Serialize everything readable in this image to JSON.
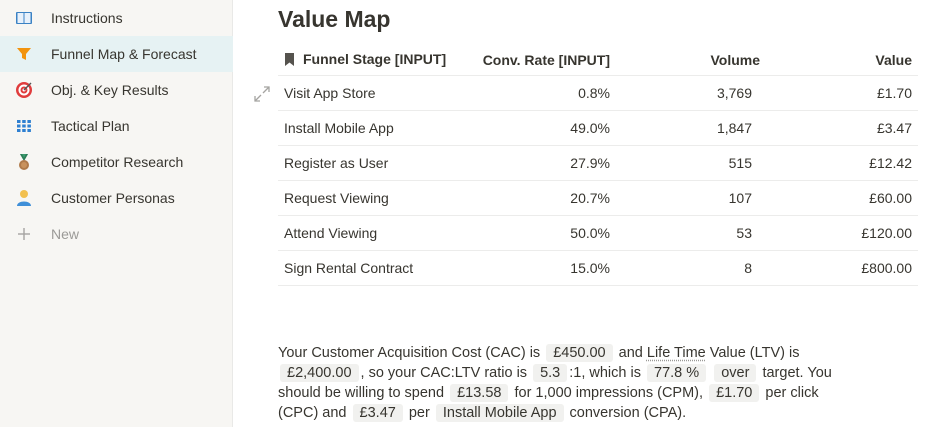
{
  "sidebar": {
    "items": [
      {
        "label": "Instructions",
        "icon": "book-icon"
      },
      {
        "label": "Funnel Map & Forecast",
        "icon": "funnel-icon",
        "active": true
      },
      {
        "label": "Obj. & Key Results",
        "icon": "target-icon"
      },
      {
        "label": "Tactical Plan",
        "icon": "grid-icon"
      },
      {
        "label": "Competitor Research",
        "icon": "medal-icon"
      },
      {
        "label": "Customer Personas",
        "icon": "person-icon"
      }
    ],
    "new_label": "New"
  },
  "page": {
    "title": "Value Map"
  },
  "table": {
    "headers": [
      "Funnel Stage [INPUT]",
      "Conv. Rate [INPUT]",
      "Volume",
      "Value"
    ],
    "rows": [
      {
        "stage": "Visit App Store",
        "rate": "0.8%",
        "volume": "3,769",
        "value": "£1.70"
      },
      {
        "stage": "Install Mobile App",
        "rate": "49.0%",
        "volume": "1,847",
        "value": "£3.47"
      },
      {
        "stage": "Register as User",
        "rate": "27.9%",
        "volume": "515",
        "value": "£12.42"
      },
      {
        "stage": "Request Viewing",
        "rate": "20.7%",
        "volume": "107",
        "value": "£60.00"
      },
      {
        "stage": "Attend Viewing",
        "rate": "50.0%",
        "volume": "53",
        "value": "£120.00"
      },
      {
        "stage": "Sign Rental Contract",
        "rate": "15.0%",
        "volume": "8",
        "value": "£800.00"
      }
    ]
  },
  "summary": {
    "t1": "Your Customer Acquisition Cost (CAC) is",
    "cac": "£450.00",
    "t2": "and",
    "ltv_term": "Life Time",
    "t3": "Value (LTV) is",
    "ltv": "£2,400.00",
    "t4": ", so your CAC:LTV ratio is",
    "ratio": "5.3",
    "t5": ":1, which is",
    "pct": "77.8",
    "pct_unit": "%",
    "direction": "over",
    "t6": "target.",
    "t7": "You should be willing to spend",
    "cpm": "£13.58",
    "t8": "for 1,000 impressions (CPM),",
    "cpc": "£1.70",
    "t9": "per click (CPC) and",
    "cpa": "£3.47",
    "t10": "per",
    "stage": "Install Mobile App",
    "t11": "conversion (CPA)."
  }
}
